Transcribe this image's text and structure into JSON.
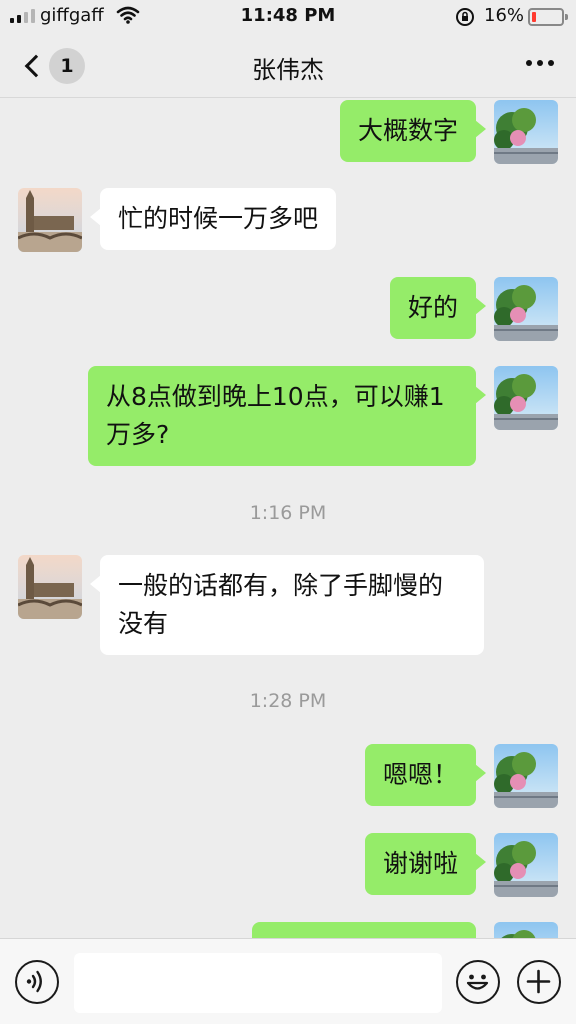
{
  "status_bar": {
    "carrier": "giffgaff",
    "time": "11:48 PM",
    "battery_percent": "16%",
    "battery_level": 0.16,
    "icons": [
      "signal-icon",
      "wifi-icon",
      "rotation-lock-icon",
      "battery-icon"
    ]
  },
  "nav": {
    "back_badge": "1",
    "title": "张伟杰",
    "icons": [
      "back-chevron-icon",
      "more-icon"
    ]
  },
  "messages": [
    {
      "from": "me",
      "text": "大概数字"
    },
    {
      "from": "them",
      "text": "忙的时候一万多吧"
    },
    {
      "from": "me",
      "text": "好的"
    },
    {
      "from": "me",
      "text_line1": "从8点做到晚上10点，可以赚1",
      "text_line2": "万多?"
    },
    {
      "type": "time",
      "text": "1:16 PM"
    },
    {
      "from": "them",
      "text_line1": "一般的话都有，除了手脚慢的",
      "text_line2": "没有"
    },
    {
      "type": "time",
      "text": "1:28 PM"
    },
    {
      "from": "me",
      "text": "嗯嗯！"
    },
    {
      "from": "me",
      "text": "谢谢啦"
    },
    {
      "from": "me",
      "text": ""
    }
  ],
  "input_bar": {
    "icons": [
      "voice-icon",
      "emoji-icon",
      "plus-icon"
    ],
    "text_value": ""
  },
  "colors": {
    "background": "#ededed",
    "my_bubble": "#95ec69",
    "their_bubble": "#ffffff",
    "battery_low": "#ff3b30"
  }
}
